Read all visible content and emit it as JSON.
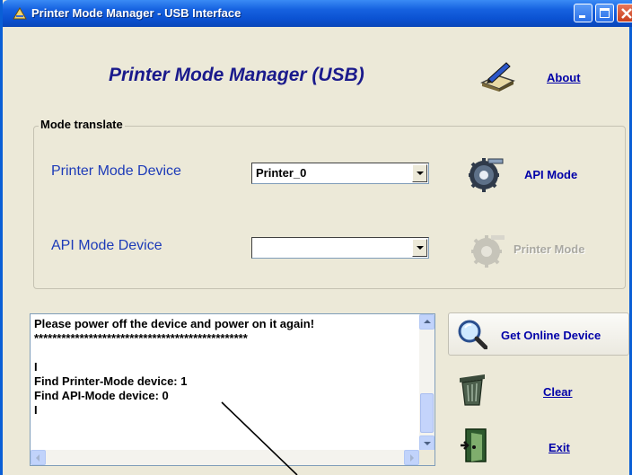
{
  "window": {
    "title": "Printer Mode Manager - USB Interface"
  },
  "header": {
    "heading": "Printer Mode Manager (USB)",
    "about_label": "About"
  },
  "mode_group": {
    "title": "Mode translate",
    "printer_mode_device_label": "Printer Mode Device",
    "printer_mode_device_value": "Printer_0",
    "api_mode_button": "API Mode",
    "api_mode_device_label": "API Mode Device",
    "api_mode_device_value": "",
    "printer_mode_button": "Printer Mode",
    "printer_mode_button_enabled": false
  },
  "log": {
    "lines": [
      "Please power off the device and power on it again!",
      "***********************************************",
      "",
      "I",
      "Find Printer-Mode device: 1",
      "Find API-Mode device: 0",
      "I"
    ]
  },
  "actions": {
    "get_online_device": "Get Online Device",
    "clear": "Clear",
    "exit": "Exit"
  },
  "icons": [
    "app-icon",
    "book-pen-icon",
    "gear-icon",
    "magnifier-icon",
    "trash-can-icon",
    "exit-door-icon"
  ],
  "colors": {
    "titlebar": "#0b52d2",
    "heading": "#1a1a8c",
    "field_label": "#1d3bb8",
    "link": "#0000a8",
    "disabled": "#a9a8a0",
    "window_bg": "#ece9d8"
  }
}
